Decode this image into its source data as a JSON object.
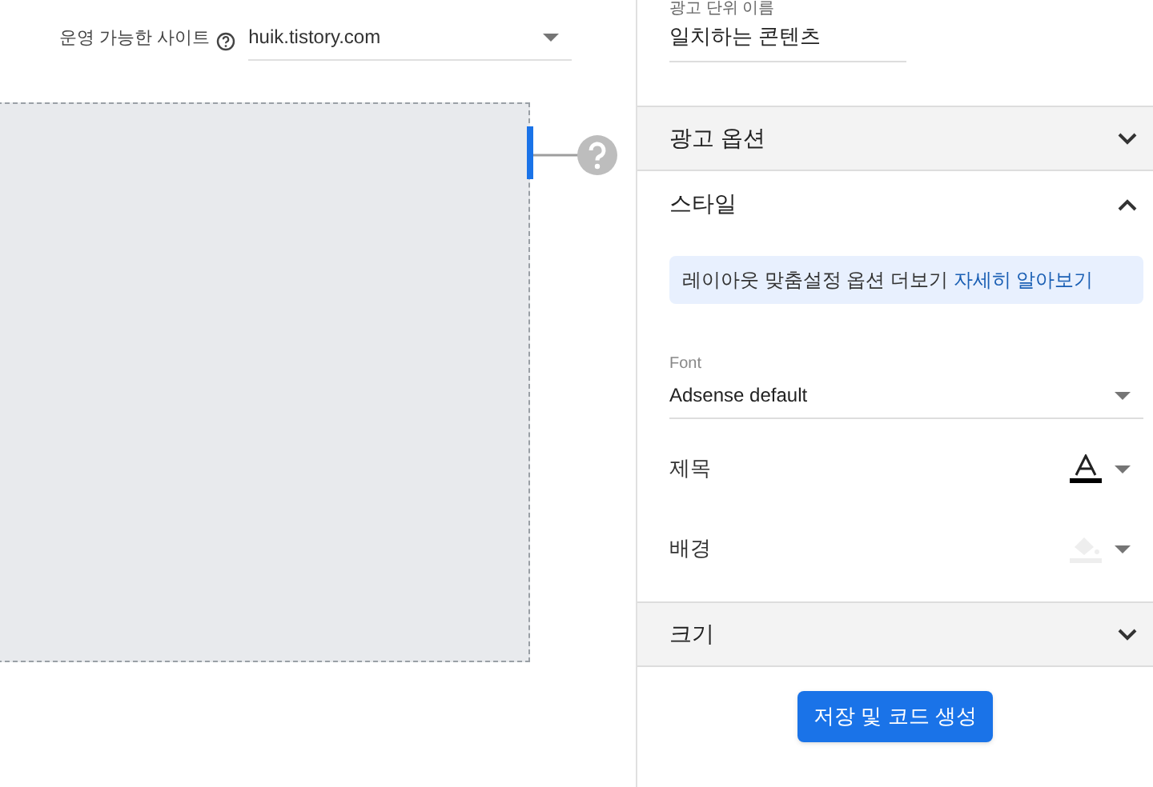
{
  "site_selector": {
    "label": "운영 가능한 사이트",
    "value": "huik.tistory.com"
  },
  "ad_unit_name": {
    "label": "광고 단위 이름",
    "value": "일치하는 콘텐츠"
  },
  "sections": [
    {
      "title": "광고 옵션",
      "expanded": false
    },
    {
      "title": "스타일",
      "expanded": true
    },
    {
      "title": "크기",
      "expanded": false
    }
  ],
  "style": {
    "notice": "레이아웃 맞춤설정 옵션 더보기",
    "notice_link": "자세히 알아보기",
    "font": {
      "label": "Font",
      "value": "Adsense default"
    },
    "colors": [
      {
        "label": "제목",
        "kind": "text",
        "color": "#000000"
      },
      {
        "label": "배경",
        "kind": "fill",
        "color": "#eeeeee"
      }
    ]
  },
  "save_button": "저장 및 코드 생성"
}
